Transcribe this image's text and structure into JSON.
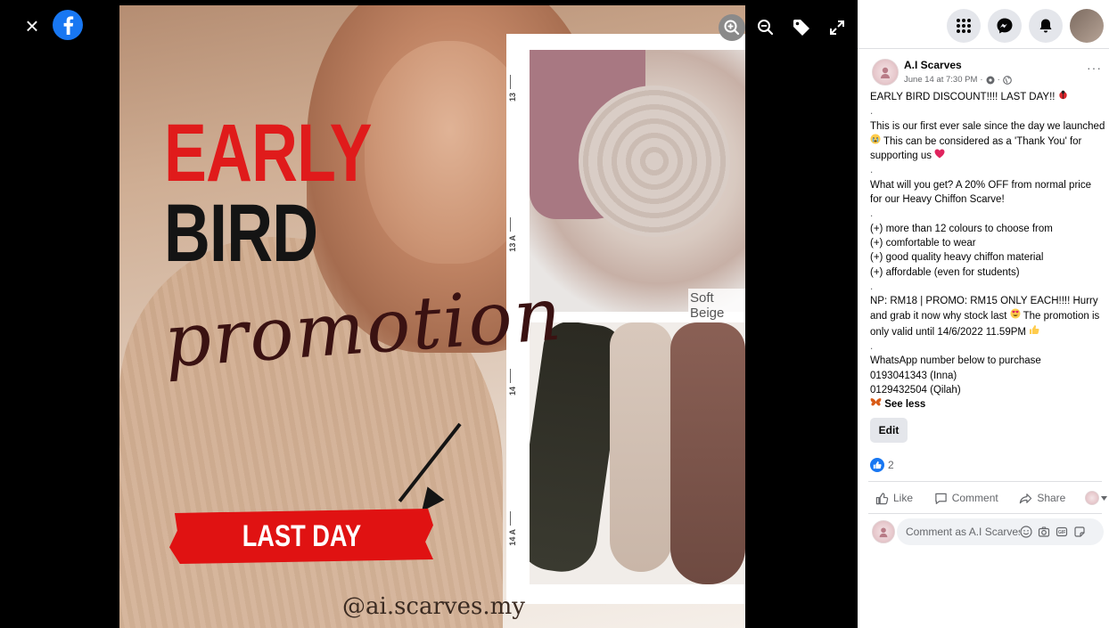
{
  "viewer": {
    "close_glyph": "×",
    "icons": [
      "facebook-logo-icon",
      "zoom-in-icon",
      "zoom-out-icon",
      "tag-icon",
      "fullscreen-icon"
    ],
    "image": {
      "headline_1": "EARLY",
      "headline_2": "BIRD",
      "script_word": "promotion",
      "banner": "LAST DAY",
      "color_label": "Soft Beige",
      "handle": "@ai.scarves.my",
      "size_marks": [
        "13",
        "13 A",
        "14",
        "14 A"
      ]
    }
  },
  "colors": {
    "facebook_blue": "#1877f2",
    "headline_red": "#e01b1b",
    "banner_red": "#e01212"
  },
  "nav": {
    "icons": [
      "menu-grid-icon",
      "messenger-icon",
      "notifications-bell-icon",
      "profile-avatar"
    ]
  },
  "post": {
    "page_name": "A.I Scarves",
    "timestamp": "June 14 at 7:30 PM",
    "meta_sep": "·",
    "more_glyph": "···",
    "lines": {
      "l1": "EARLY BIRD DISCOUNT!!!! LAST DAY!! ",
      "d1": ".",
      "l2a": "This is our first ever sale since the day we launched ",
      "l2b": " This can be considered as a 'Thank You' for supporting us ",
      "d2": ".",
      "l3": "What will you get? A 20% OFF from normal price for our Heavy Chiffon Scarve!",
      "d3": ".",
      "b1": "(+) more than 12 colours to choose from",
      "b2": "(+) comfortable to wear",
      "b3": "(+) good quality heavy chiffon material",
      "b4": "(+) affordable (even for students)",
      "d4": ".",
      "l4a": "NP: RM18 | PROMO: RM15 ONLY EACH!!!! Hurry and grab it now why stock last ",
      "l4b": " The promotion is only valid until 14/6/2022 11.59PM ",
      "d5": ".",
      "l5": "WhatsApp number below to purchase",
      "p1": "0193041343 (Inna)",
      "p2": "0129432504 (Qilah)",
      "see_less": "See less"
    },
    "edit_label": "Edit",
    "reaction_count": "2",
    "actions": {
      "like": "Like",
      "comment": "Comment",
      "share": "Share"
    },
    "comment_placeholder": "Comment as A.I Scarves"
  }
}
